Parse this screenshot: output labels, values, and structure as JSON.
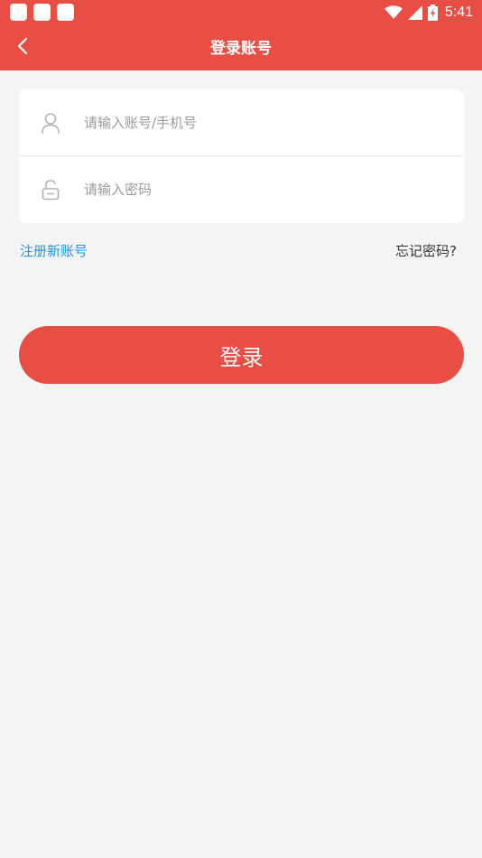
{
  "status_bar": {
    "time": "5:41",
    "icons": [
      "wifi-icon",
      "signal-icon",
      "battery-icon"
    ]
  },
  "nav": {
    "title": "登录账号",
    "back_icon": "chevron-left-icon"
  },
  "form": {
    "account": {
      "placeholder": "请输入账号/手机号",
      "value": "",
      "icon": "user-icon"
    },
    "password": {
      "placeholder": "请输入密码",
      "value": "",
      "icon": "lock-icon"
    }
  },
  "links": {
    "register": "注册新账号",
    "forgot": "忘记密码?"
  },
  "login_button": {
    "label": "登录"
  },
  "colors": {
    "primary": "#e84e43",
    "link": "#2196e0",
    "background": "#f4f4f4"
  }
}
